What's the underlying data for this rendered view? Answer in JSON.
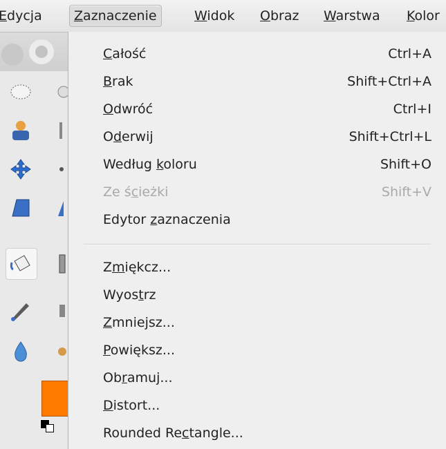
{
  "menubar": {
    "items": [
      {
        "label": "Edycja",
        "mnemonic_index": 0
      },
      {
        "label": "Zaznaczenie",
        "mnemonic_index": 0
      },
      {
        "label": "Widok",
        "mnemonic_index": 0
      },
      {
        "label": "Obraz",
        "mnemonic_index": 0
      },
      {
        "label": "Warstwa",
        "mnemonic_index": 0
      },
      {
        "label": "Kolor",
        "mnemonic_index": 0
      }
    ]
  },
  "menu": {
    "items": [
      {
        "label": "Całość",
        "shortcut": "Ctrl+A",
        "mnemonic": 0,
        "disabled": false
      },
      {
        "label": "Brak",
        "shortcut": "Shift+Ctrl+A",
        "mnemonic": 0,
        "disabled": false
      },
      {
        "label": "Odwróć",
        "shortcut": "Ctrl+I",
        "mnemonic": 0,
        "disabled": false
      },
      {
        "label": "Oderwij",
        "shortcut": "Shift+Ctrl+L",
        "mnemonic": 1,
        "disabled": false
      },
      {
        "label": "Według koloru",
        "shortcut": "Shift+O",
        "mnemonic": 7,
        "disabled": false
      },
      {
        "label": "Ze ścieżki",
        "shortcut": "Shift+V",
        "mnemonic": 4,
        "disabled": true
      },
      {
        "label": "Edytor zaznaczenia",
        "shortcut": "",
        "mnemonic": 7,
        "disabled": false
      }
    ],
    "items2": [
      {
        "label": "Zmiękcz...",
        "shortcut": "",
        "mnemonic": 1,
        "disabled": false
      },
      {
        "label": "Wyostrz",
        "shortcut": "",
        "mnemonic": 4,
        "disabled": false
      },
      {
        "label": "Zmniejsz...",
        "shortcut": "",
        "mnemonic": 0,
        "disabled": false
      },
      {
        "label": "Powiększ...",
        "shortcut": "",
        "mnemonic": 0,
        "disabled": false
      },
      {
        "label": "Obramuj...",
        "shortcut": "",
        "mnemonic": 2,
        "disabled": false
      },
      {
        "label": "Distort...",
        "shortcut": "",
        "mnemonic": 0,
        "disabled": false
      },
      {
        "label": "Rounded Rectangle...",
        "shortcut": "",
        "mnemonic": 10,
        "disabled": false
      }
    ]
  },
  "toolbox": {
    "tools": [
      "ellipse-select-icon",
      "fuzzy-select-icon",
      "move-icon",
      "perspective-icon",
      "bucket-fill-icon",
      "ink-pen-icon",
      "blur-drop-icon"
    ],
    "foreground_color": "#ff7b00"
  },
  "colors": {
    "menu_bg": "#efefef",
    "disabled_text": "#a9a9a9"
  }
}
